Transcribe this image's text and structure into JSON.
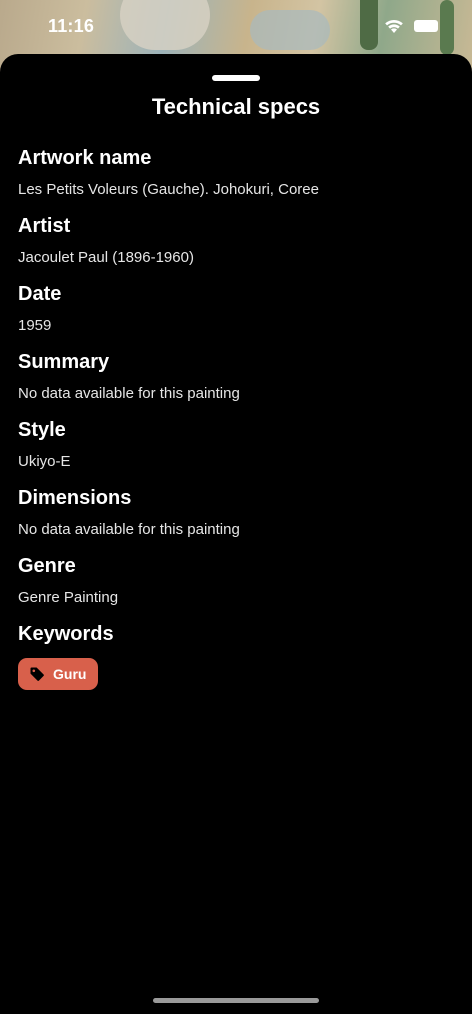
{
  "status_bar": {
    "time": "11:16"
  },
  "sheet": {
    "title": "Technical specs"
  },
  "specs": [
    {
      "label": "Artwork name",
      "value": "Les Petits Voleurs (Gauche). Johokuri, Coree"
    },
    {
      "label": "Artist",
      "value": "Jacoulet Paul (1896-1960)"
    },
    {
      "label": "Date",
      "value": "1959"
    },
    {
      "label": "Summary",
      "value": "No data available for this painting"
    },
    {
      "label": "Style",
      "value": "Ukiyo-E"
    },
    {
      "label": "Dimensions",
      "value": "No data available for this painting"
    },
    {
      "label": "Genre",
      "value": "Genre Painting"
    }
  ],
  "keywords": {
    "label": "Keywords",
    "items": [
      {
        "label": "Guru",
        "icon": "tag-icon"
      }
    ]
  },
  "colors": {
    "chip": "#d8604b",
    "background": "#000000",
    "text": "#ffffff"
  }
}
